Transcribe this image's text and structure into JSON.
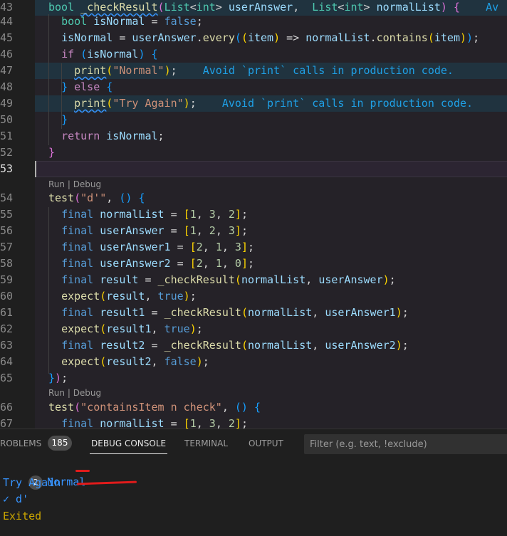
{
  "editor": {
    "lines": [
      {
        "num": "43",
        "tokens": [
          [
            "ty",
            "bool"
          ],
          [
            "pl",
            " "
          ],
          [
            "fn sq",
            "_checkResult"
          ],
          [
            "p2",
            "("
          ],
          [
            "ty",
            "List"
          ],
          [
            "pl",
            "<"
          ],
          [
            "ty",
            "int"
          ],
          [
            "pl",
            "> "
          ],
          [
            "var",
            "userAnswer"
          ],
          [
            "pl",
            ",  "
          ],
          [
            "ty",
            "List"
          ],
          [
            "pl",
            "<"
          ],
          [
            "ty",
            "int"
          ],
          [
            "pl",
            "> "
          ],
          [
            "var",
            "normalList"
          ],
          [
            "p2",
            ")"
          ],
          [
            "pl",
            " "
          ],
          [
            "p2",
            "{"
          ],
          [
            "hint",
            "    Av"
          ]
        ]
      },
      {
        "num": "44",
        "tokens": [
          [
            "pl",
            "  "
          ],
          [
            "ty",
            "bool"
          ],
          [
            "pl",
            " "
          ],
          [
            "var",
            "isNormal"
          ],
          [
            "pl",
            " = "
          ],
          [
            "kw",
            "false"
          ],
          [
            "pl",
            ";"
          ]
        ]
      },
      {
        "num": "45",
        "tokens": [
          [
            "pl",
            "  "
          ],
          [
            "var",
            "isNormal"
          ],
          [
            "pl",
            " = "
          ],
          [
            "var",
            "userAnswer"
          ],
          [
            "pl",
            "."
          ],
          [
            "fn",
            "every"
          ],
          [
            "p3",
            "("
          ],
          [
            "p1",
            "("
          ],
          [
            "var",
            "item"
          ],
          [
            "p1",
            ")"
          ],
          [
            "pl",
            " => "
          ],
          [
            "var",
            "normalList"
          ],
          [
            "pl",
            "."
          ],
          [
            "fn",
            "contains"
          ],
          [
            "p1",
            "("
          ],
          [
            "var",
            "item"
          ],
          [
            "p1",
            ")"
          ],
          [
            "p3",
            ")"
          ],
          [
            "pl",
            ";"
          ]
        ]
      },
      {
        "num": "46",
        "tokens": [
          [
            "pl",
            "  "
          ],
          [
            "kw2",
            "if"
          ],
          [
            "pl",
            " "
          ],
          [
            "p3",
            "("
          ],
          [
            "var",
            "isNormal"
          ],
          [
            "p3",
            ")"
          ],
          [
            "pl",
            " "
          ],
          [
            "p3",
            "{"
          ]
        ]
      },
      {
        "num": "47",
        "tokens": [
          [
            "pl",
            "    "
          ],
          [
            "fn sq",
            "print"
          ],
          [
            "p1",
            "("
          ],
          [
            "str",
            "\"Normal\""
          ],
          [
            "p1",
            ")"
          ],
          [
            "pl",
            ";"
          ],
          [
            "hint",
            "    Avoid `print` calls in production code."
          ]
        ]
      },
      {
        "num": "48",
        "tokens": [
          [
            "pl",
            "  "
          ],
          [
            "p3",
            "}"
          ],
          [
            "pl",
            " "
          ],
          [
            "kw2",
            "else"
          ],
          [
            "pl",
            " "
          ],
          [
            "p3",
            "{"
          ]
        ]
      },
      {
        "num": "49",
        "tokens": [
          [
            "pl",
            "    "
          ],
          [
            "fn sq",
            "print"
          ],
          [
            "p1",
            "("
          ],
          [
            "str",
            "\"Try Again\""
          ],
          [
            "p1",
            ")"
          ],
          [
            "pl",
            ";"
          ],
          [
            "hint",
            "    Avoid `print` calls in production code."
          ]
        ]
      },
      {
        "num": "50",
        "tokens": [
          [
            "pl",
            "  "
          ],
          [
            "p3",
            "}"
          ]
        ]
      },
      {
        "num": "51",
        "tokens": [
          [
            "pl",
            "  "
          ],
          [
            "kw2",
            "return"
          ],
          [
            "pl",
            " "
          ],
          [
            "var",
            "isNormal"
          ],
          [
            "pl",
            ";"
          ]
        ]
      },
      {
        "num": "52",
        "tokens": [
          [
            "p2",
            "}"
          ]
        ]
      },
      {
        "num": "53",
        "tokens": []
      },
      {
        "num": "54",
        "tokens": [
          [
            "fn",
            "test"
          ],
          [
            "p2",
            "("
          ],
          [
            "str",
            "\"d'\""
          ],
          [
            "pl",
            ", "
          ],
          [
            "p3",
            "()"
          ],
          [
            "pl",
            " "
          ],
          [
            "p3",
            "{"
          ]
        ]
      },
      {
        "num": "55",
        "tokens": [
          [
            "pl",
            "  "
          ],
          [
            "kw",
            "final"
          ],
          [
            "pl",
            " "
          ],
          [
            "var",
            "normalList"
          ],
          [
            "pl",
            " = "
          ],
          [
            "p1",
            "["
          ],
          [
            "num",
            "1"
          ],
          [
            "pl",
            ", "
          ],
          [
            "num",
            "3"
          ],
          [
            "pl",
            ", "
          ],
          [
            "num",
            "2"
          ],
          [
            "p1",
            "]"
          ],
          [
            "pl",
            ";"
          ]
        ]
      },
      {
        "num": "56",
        "tokens": [
          [
            "pl",
            "  "
          ],
          [
            "kw",
            "final"
          ],
          [
            "pl",
            " "
          ],
          [
            "var",
            "userAnswer"
          ],
          [
            "pl",
            " = "
          ],
          [
            "p1",
            "["
          ],
          [
            "num",
            "1"
          ],
          [
            "pl",
            ", "
          ],
          [
            "num",
            "2"
          ],
          [
            "pl",
            ", "
          ],
          [
            "num",
            "3"
          ],
          [
            "p1",
            "]"
          ],
          [
            "pl",
            ";"
          ]
        ]
      },
      {
        "num": "57",
        "tokens": [
          [
            "pl",
            "  "
          ],
          [
            "kw",
            "final"
          ],
          [
            "pl",
            " "
          ],
          [
            "var",
            "userAnswer1"
          ],
          [
            "pl",
            " = "
          ],
          [
            "p1",
            "["
          ],
          [
            "num",
            "2"
          ],
          [
            "pl",
            ", "
          ],
          [
            "num",
            "1"
          ],
          [
            "pl",
            ", "
          ],
          [
            "num",
            "3"
          ],
          [
            "p1",
            "]"
          ],
          [
            "pl",
            ";"
          ]
        ]
      },
      {
        "num": "58",
        "tokens": [
          [
            "pl",
            "  "
          ],
          [
            "kw",
            "final"
          ],
          [
            "pl",
            " "
          ],
          [
            "var",
            "userAnswer2"
          ],
          [
            "pl",
            " = "
          ],
          [
            "p1",
            "["
          ],
          [
            "num",
            "2"
          ],
          [
            "pl",
            ", "
          ],
          [
            "num",
            "1"
          ],
          [
            "pl",
            ", "
          ],
          [
            "num",
            "0"
          ],
          [
            "p1",
            "]"
          ],
          [
            "pl",
            ";"
          ]
        ]
      },
      {
        "num": "59",
        "tokens": [
          [
            "pl",
            "  "
          ],
          [
            "kw",
            "final"
          ],
          [
            "pl",
            " "
          ],
          [
            "var",
            "result"
          ],
          [
            "pl",
            " = "
          ],
          [
            "fn",
            "_checkResult"
          ],
          [
            "p1",
            "("
          ],
          [
            "var",
            "normalList"
          ],
          [
            "pl",
            ", "
          ],
          [
            "var",
            "userAnswer"
          ],
          [
            "p1",
            ")"
          ],
          [
            "pl",
            ";"
          ]
        ]
      },
      {
        "num": "60",
        "tokens": [
          [
            "pl",
            "  "
          ],
          [
            "fn",
            "expect"
          ],
          [
            "p1",
            "("
          ],
          [
            "var",
            "result"
          ],
          [
            "pl",
            ", "
          ],
          [
            "kw",
            "true"
          ],
          [
            "p1",
            ")"
          ],
          [
            "pl",
            ";"
          ]
        ]
      },
      {
        "num": "61",
        "tokens": [
          [
            "pl",
            "  "
          ],
          [
            "kw",
            "final"
          ],
          [
            "pl",
            " "
          ],
          [
            "var",
            "result1"
          ],
          [
            "pl",
            " = "
          ],
          [
            "fn",
            "_checkResult"
          ],
          [
            "p1",
            "("
          ],
          [
            "var",
            "normalList"
          ],
          [
            "pl",
            ", "
          ],
          [
            "var",
            "userAnswer1"
          ],
          [
            "p1",
            ")"
          ],
          [
            "pl",
            ";"
          ]
        ]
      },
      {
        "num": "62",
        "tokens": [
          [
            "pl",
            "  "
          ],
          [
            "fn",
            "expect"
          ],
          [
            "p1",
            "("
          ],
          [
            "var",
            "result1"
          ],
          [
            "pl",
            ", "
          ],
          [
            "kw",
            "true"
          ],
          [
            "p1",
            ")"
          ],
          [
            "pl",
            ";"
          ]
        ]
      },
      {
        "num": "63",
        "tokens": [
          [
            "pl",
            "  "
          ],
          [
            "kw",
            "final"
          ],
          [
            "pl",
            " "
          ],
          [
            "var",
            "result2"
          ],
          [
            "pl",
            " = "
          ],
          [
            "fn",
            "_checkResult"
          ],
          [
            "p1",
            "("
          ],
          [
            "var",
            "normalList"
          ],
          [
            "pl",
            ", "
          ],
          [
            "var",
            "userAnswer2"
          ],
          [
            "p1",
            ")"
          ],
          [
            "pl",
            ";"
          ]
        ]
      },
      {
        "num": "64",
        "tokens": [
          [
            "pl",
            "  "
          ],
          [
            "fn",
            "expect"
          ],
          [
            "p1",
            "("
          ],
          [
            "var",
            "result2"
          ],
          [
            "pl",
            ", "
          ],
          [
            "kw",
            "false"
          ],
          [
            "p1",
            ")"
          ],
          [
            "pl",
            ";"
          ]
        ]
      },
      {
        "num": "65",
        "tokens": [
          [
            "p3",
            "}"
          ],
          [
            "p2",
            ")"
          ],
          [
            "pl",
            ";"
          ]
        ]
      },
      {
        "num": "66",
        "tokens": [
          [
            "fn",
            "test"
          ],
          [
            "p2",
            "("
          ],
          [
            "str",
            "\"containsItem n check\""
          ],
          [
            "pl",
            ", "
          ],
          [
            "p3",
            "()"
          ],
          [
            "pl",
            " "
          ],
          [
            "p3",
            "{"
          ]
        ]
      },
      {
        "num": "67",
        "tokens": [
          [
            "pl",
            "  "
          ],
          [
            "kw",
            "final"
          ],
          [
            "pl",
            " "
          ],
          [
            "var",
            "normalList"
          ],
          [
            "pl",
            " = "
          ],
          [
            "p1",
            "["
          ],
          [
            "num",
            "1"
          ],
          [
            "pl",
            ", "
          ],
          [
            "num",
            "3"
          ],
          [
            "pl",
            ", "
          ],
          [
            "num",
            "2"
          ],
          [
            "p1",
            "]"
          ],
          [
            "pl",
            ";"
          ]
        ]
      }
    ],
    "codelens": {
      "run": "Run",
      "sep": " | ",
      "debug": "Debug"
    }
  },
  "panel": {
    "tabs": [
      {
        "label": "ROBLEMS",
        "badge": "185"
      },
      {
        "label": "DEBUG CONSOLE",
        "active": true
      },
      {
        "label": "TERMINAL"
      },
      {
        "label": "OUTPUT"
      }
    ],
    "filter_placeholder": "Filter (e.g. text, !exclude)",
    "output": {
      "line1_count": "2",
      "line1_text": "Normal",
      "line2_text": "Try Again",
      "line3_text": "✓ d'",
      "line4_text": "Exited"
    },
    "colors": {
      "log": "#3794ff",
      "exit": "#cca700",
      "annotation": "#e01b1b"
    }
  }
}
